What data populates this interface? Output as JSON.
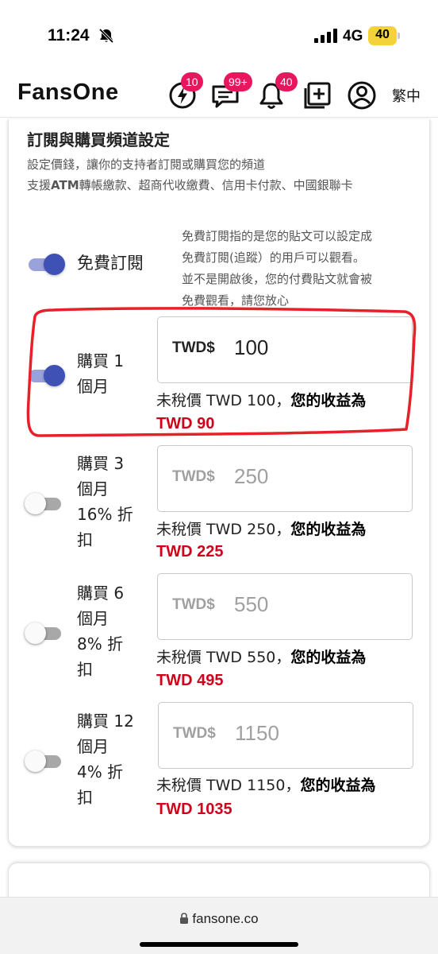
{
  "status_bar": {
    "time": "11:24",
    "network": "4G",
    "battery": "40",
    "icons": [
      "bell-off-icon",
      "signal-icon",
      "battery-icon"
    ]
  },
  "header": {
    "logo": "FansOne",
    "icons": [
      {
        "name": "lightning-icon",
        "badge": "10"
      },
      {
        "name": "chat-icon",
        "badge": "99+"
      },
      {
        "name": "bell-icon",
        "badge": "40"
      },
      {
        "name": "add-post-icon",
        "badge": ""
      },
      {
        "name": "profile-icon",
        "badge": ""
      }
    ],
    "language": "繁中"
  },
  "colors": {
    "accent": "#3f51b5",
    "badge": "#e8175d",
    "earnings": "#d0021b",
    "highlight": "#e8202a"
  },
  "section": {
    "title": "訂閱與購買頻道設定",
    "desc1": "設定價錢，讓你的支持者訂閱或購買您的頻道",
    "desc2_prefix": "支援",
    "desc2_atm": "ATM",
    "desc2_rest": "轉帳繳款、超商代收繳費、信用卡付款、中國銀聯卡"
  },
  "free_sub": {
    "label": "免費訂閱",
    "enabled": true,
    "note": [
      "免費訂閱指的是您的貼文可以設定成",
      "免費訂閱(追蹤）的用戶可以觀看。",
      "並不是開啟後，您的付費貼文就會被",
      "免費觀看，請您放心"
    ]
  },
  "plans": [
    {
      "label_lines": [
        "購買 1",
        "個月"
      ],
      "enabled": true,
      "currency": "TWD$",
      "price": "100",
      "tax_text": "未稅價 TWD 100，",
      "earn_label": "您的收益為",
      "earn_value": "TWD 90"
    },
    {
      "label_lines": [
        "購買 3",
        "個月",
        "16% 折",
        "扣"
      ],
      "enabled": false,
      "currency": "TWD$",
      "price": "250",
      "tax_text": "未稅價 TWD 250，",
      "earn_label": "您的收益為",
      "earn_value": "TWD 225"
    },
    {
      "label_lines": [
        "購買 6",
        "個月",
        "8% 折",
        "扣"
      ],
      "enabled": false,
      "currency": "TWD$",
      "price": "550",
      "tax_text": "未稅價 TWD 550，",
      "earn_label": "您的收益為",
      "earn_value": "TWD 495"
    },
    {
      "label_lines": [
        "購買 12",
        "個月",
        "4% 折",
        "扣"
      ],
      "enabled": false,
      "currency": "TWD$",
      "price": "1150",
      "tax_text": "未稅價 TWD 1150，",
      "earn_label": "您的收益為",
      "earn_value": "TWD 1035"
    }
  ],
  "browser": {
    "url": "fansone.co"
  }
}
